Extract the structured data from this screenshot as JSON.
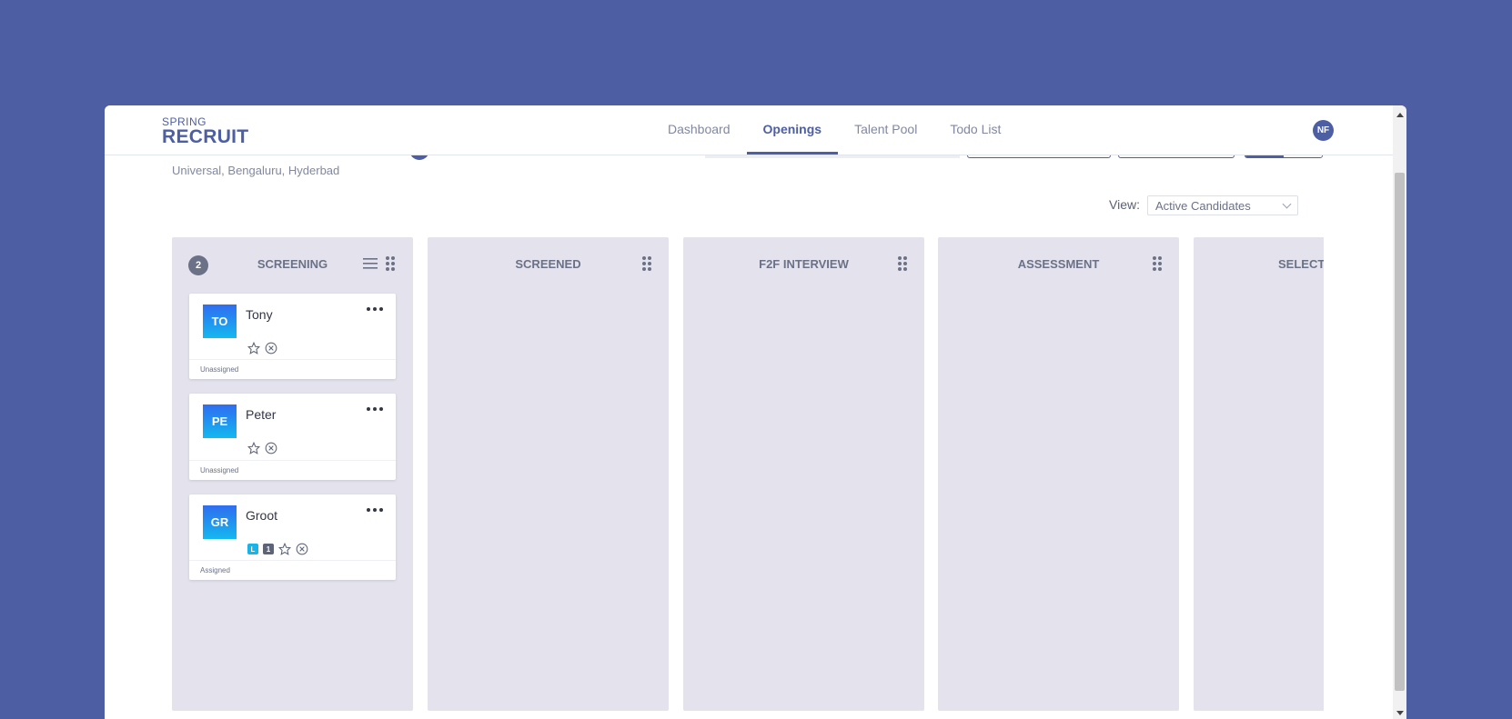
{
  "header": {
    "logo_small": "SPRING",
    "logo_big": "RECRUIT",
    "nav": [
      {
        "label": "Dashboard",
        "active": false
      },
      {
        "label": "Openings",
        "active": true
      },
      {
        "label": "Talent Pool",
        "active": false
      },
      {
        "label": "Todo List",
        "active": false
      }
    ],
    "user_initials": "NF"
  },
  "opening": {
    "location": "Universal, Bengaluru, Hyderbad"
  },
  "view": {
    "label": "View:",
    "selected": "Active Candidates"
  },
  "columns": [
    {
      "title": "SCREENING",
      "count": "2",
      "cards": [
        {
          "initials": "TO",
          "name": "Tony",
          "status": "Unassigned",
          "tags": []
        },
        {
          "initials": "PE",
          "name": "Peter",
          "status": "Unassigned",
          "tags": []
        },
        {
          "initials": "GR",
          "name": "Groot",
          "status": "Assigned",
          "tags": [
            "L",
            "1"
          ]
        }
      ]
    },
    {
      "title": "SCREENED",
      "cards": []
    },
    {
      "title": "F2F INTERVIEW",
      "cards": []
    },
    {
      "title": "ASSESSMENT",
      "cards": []
    },
    {
      "title": "SELECTI",
      "cards": []
    }
  ],
  "colors": {
    "background": "#4e5ea3",
    "brand": "#4e5ea3",
    "column_bg": "#e4e3ed",
    "avatar_gradient_top": "#2f6df0",
    "avatar_gradient_bottom": "#14b8ef"
  },
  "icons": {
    "drag": "drag-handle-icon",
    "list": "list-icon",
    "more": "more-options-icon",
    "star": "star-icon",
    "reject": "reject-icon",
    "chevron": "chevron-down-icon"
  }
}
